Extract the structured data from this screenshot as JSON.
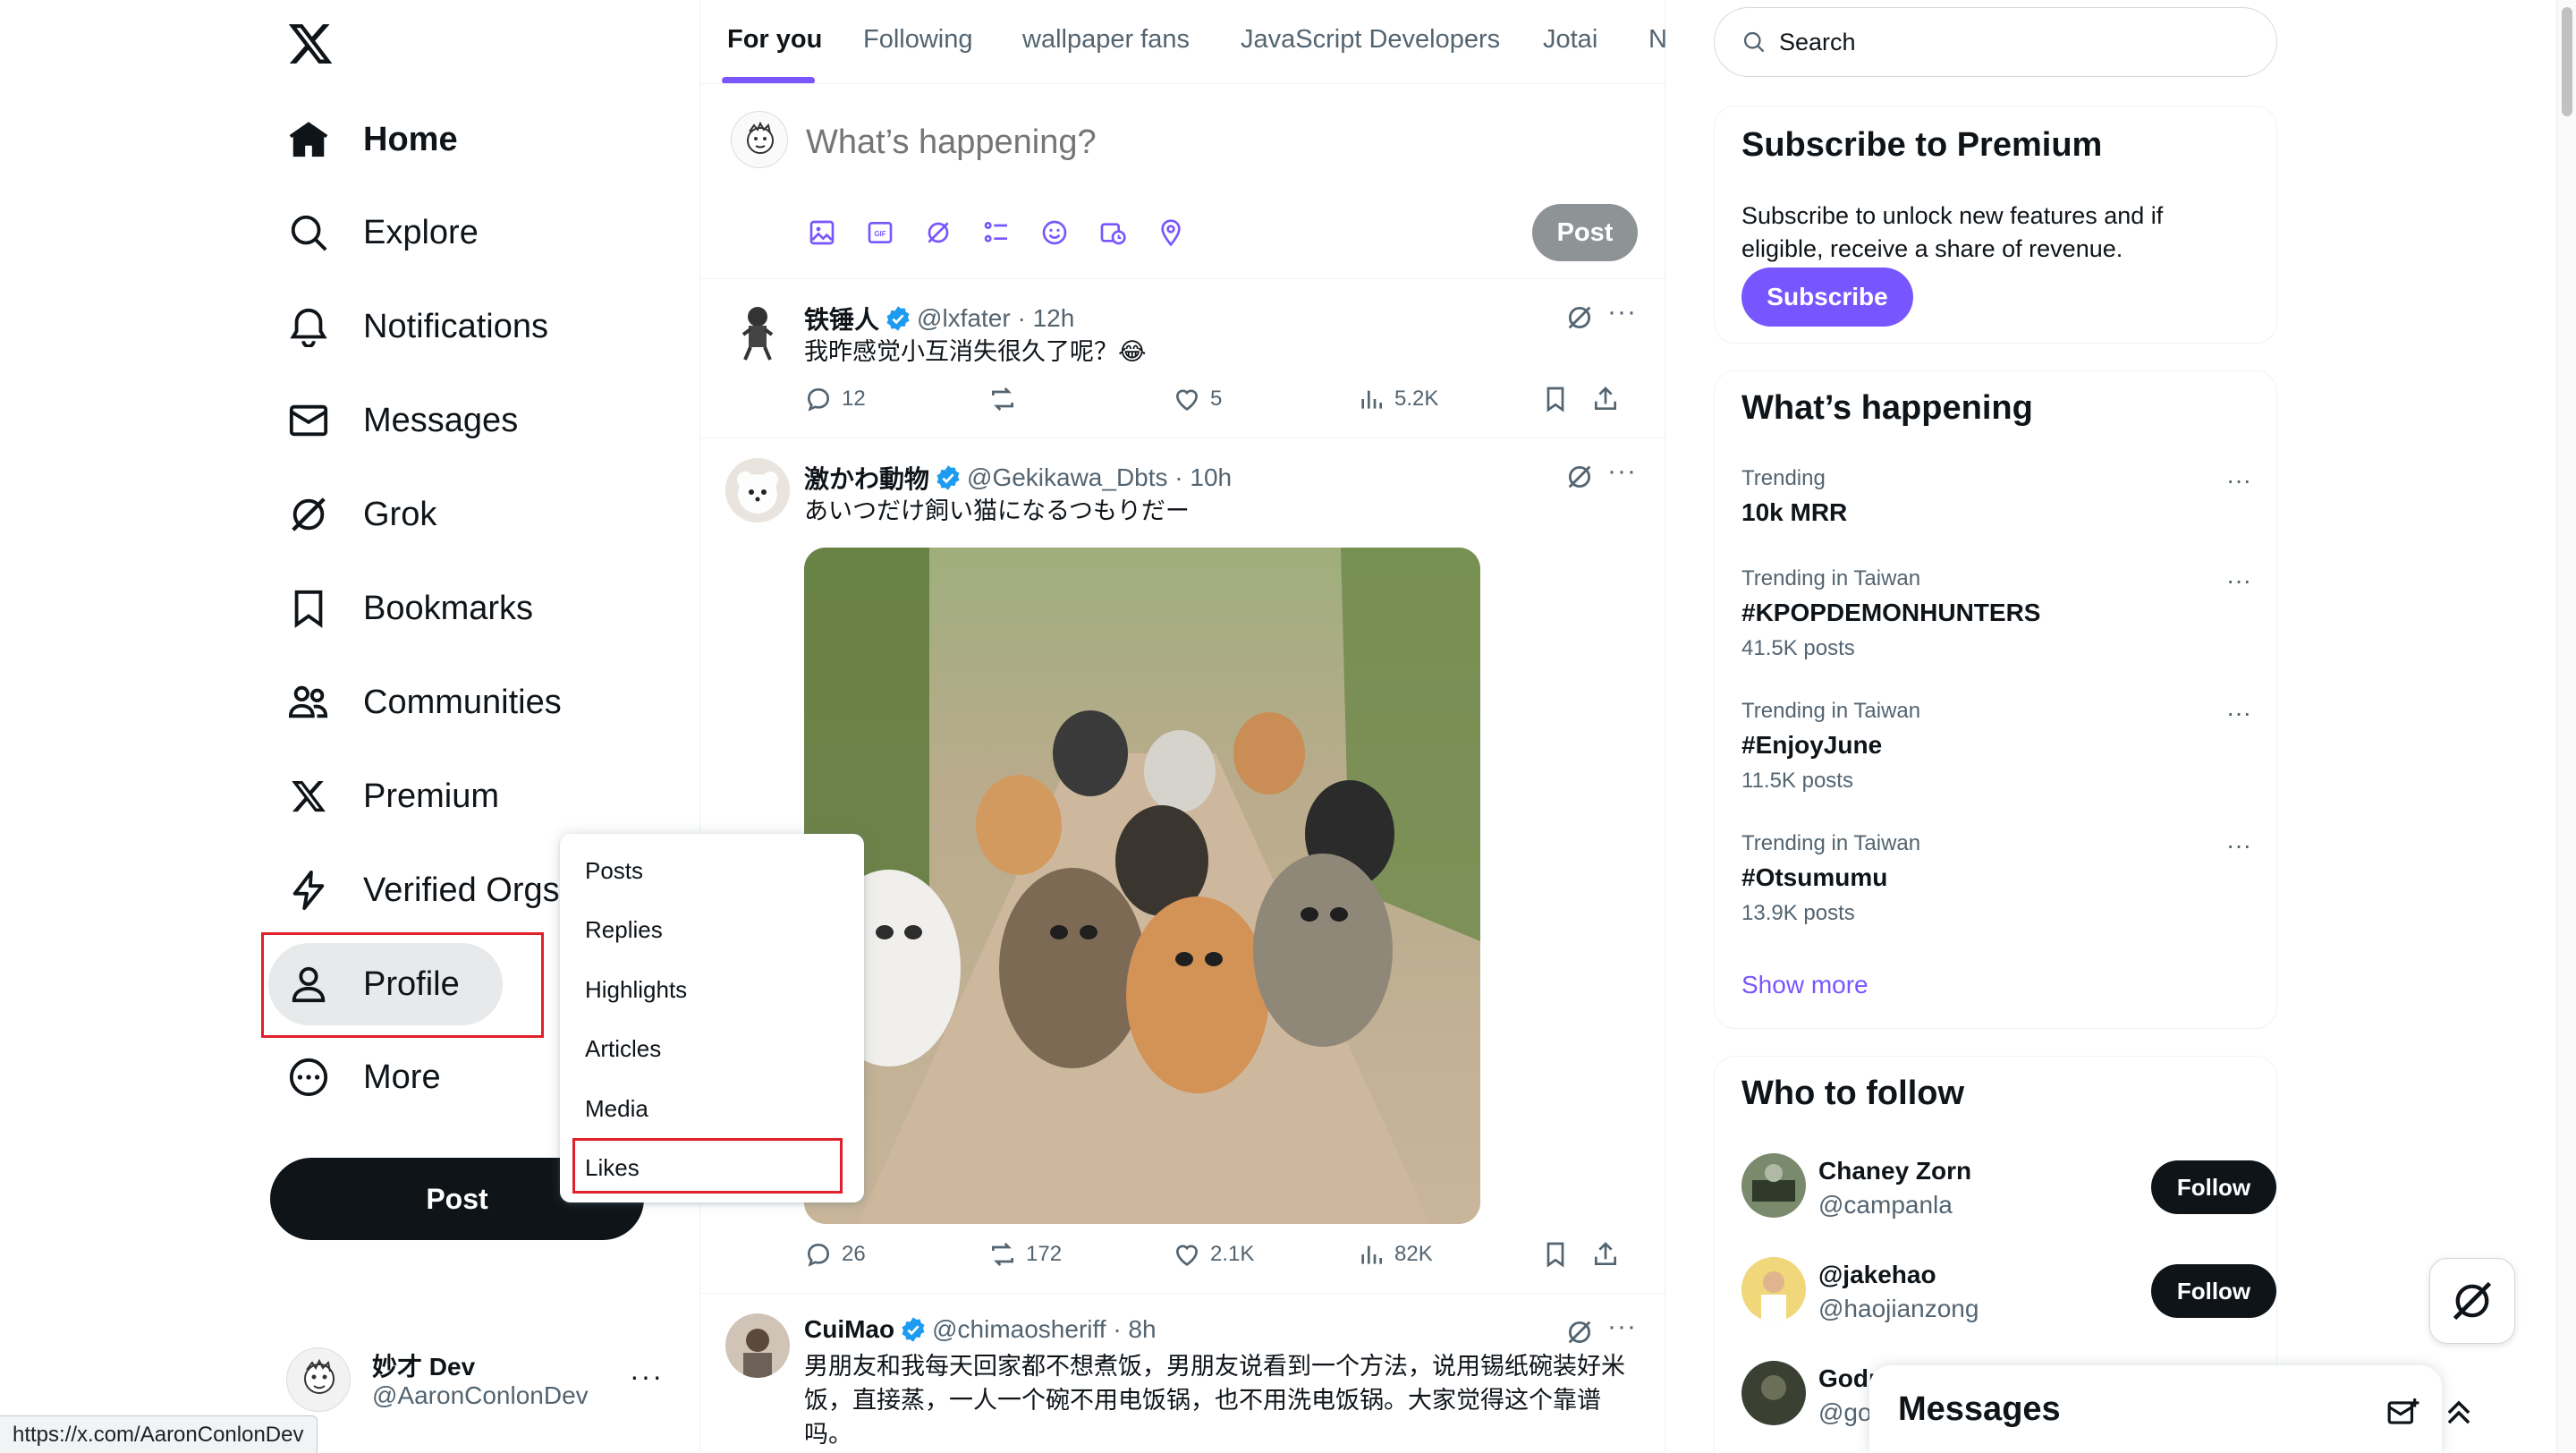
{
  "sidebar": {
    "items": [
      {
        "label": "Home",
        "icon": "home-icon"
      },
      {
        "label": "Explore",
        "icon": "search-icon"
      },
      {
        "label": "Notifications",
        "icon": "bell-icon"
      },
      {
        "label": "Messages",
        "icon": "envelope-icon"
      },
      {
        "label": "Grok",
        "icon": "grok-icon"
      },
      {
        "label": "Bookmarks",
        "icon": "bookmark-icon"
      },
      {
        "label": "Communities",
        "icon": "people-icon"
      },
      {
        "label": "Premium",
        "icon": "x-logo-icon"
      },
      {
        "label": "Verified Orgs",
        "icon": "lightning-icon"
      },
      {
        "label": "Profile",
        "icon": "person-icon"
      },
      {
        "label": "More",
        "icon": "more-circle-icon"
      }
    ],
    "post_label": "Post",
    "account": {
      "name": "妙才 Dev",
      "handle": "@AaronConlonDev",
      "more": "···"
    }
  },
  "status_url": "https://x.com/AaronConlonDev",
  "dropdown": {
    "items": [
      "Posts",
      "Replies",
      "Highlights",
      "Articles",
      "Media",
      "Likes"
    ]
  },
  "tabs": [
    "For you",
    "Following",
    "wallpaper fans",
    "JavaScript Developers",
    "Jotai",
    "N"
  ],
  "composer": {
    "placeholder": "What’s happening?",
    "post_label": "Post"
  },
  "tweets": [
    {
      "name": "铁锤人",
      "handle": "@lxfater · 12h",
      "text": "我昨感觉小互消失很久了呢？😂",
      "replies": "12",
      "retweets": "",
      "likes": "5",
      "views": "5.2K"
    },
    {
      "name": "激かわ動物",
      "handle": "@Gekikawa_Dbts · 10h",
      "text": "あいつだけ飼い猫になるつもりだー",
      "replies": "26",
      "retweets": "172",
      "likes": "2.1K",
      "views": "82K"
    },
    {
      "name": "CuiMao",
      "handle": "@chimaosheriff · 8h",
      "text": "男朋友和我每天回家都不想煮饭，男朋友说看到一个方法，说用锡纸碗装好米饭，直接蒸，一人一个碗不用电饭锅，也不用洗电饭锅。大家觉得这个靠谱吗。"
    }
  ],
  "search": {
    "placeholder": "Search"
  },
  "premium": {
    "title": "Subscribe to Premium",
    "text": "Subscribe to unlock new features and if eligible, receive a share of revenue.",
    "button": "Subscribe"
  },
  "happening": {
    "title": "What’s happening",
    "trends": [
      {
        "context": "Trending",
        "name": "10k MRR",
        "count": ""
      },
      {
        "context": "Trending in Taiwan",
        "name": "#KPOPDEMONHUNTERS",
        "count": "41.5K posts"
      },
      {
        "context": "Trending in Taiwan",
        "name": "#EnjoyJune",
        "count": "11.5K posts"
      },
      {
        "context": "Trending in Taiwan",
        "name": "#Otsumumu",
        "count": "13.9K posts"
      }
    ],
    "show_more": "Show more"
  },
  "who_to_follow": {
    "title": "Who to follow",
    "people": [
      {
        "name": "Chaney Zorn",
        "handle": "@campanla",
        "button": "Follow"
      },
      {
        "name": "@jakehao",
        "handle": "@haojianzong",
        "button": "Follow"
      },
      {
        "name": "Godr",
        "handle": "@goc",
        "button": ""
      }
    ]
  },
  "messages_drawer": {
    "title": "Messages"
  },
  "colors": {
    "accent": "#7856ff",
    "text": "#0f1419",
    "muted": "#536471",
    "highlight_box": "#e0202b"
  }
}
